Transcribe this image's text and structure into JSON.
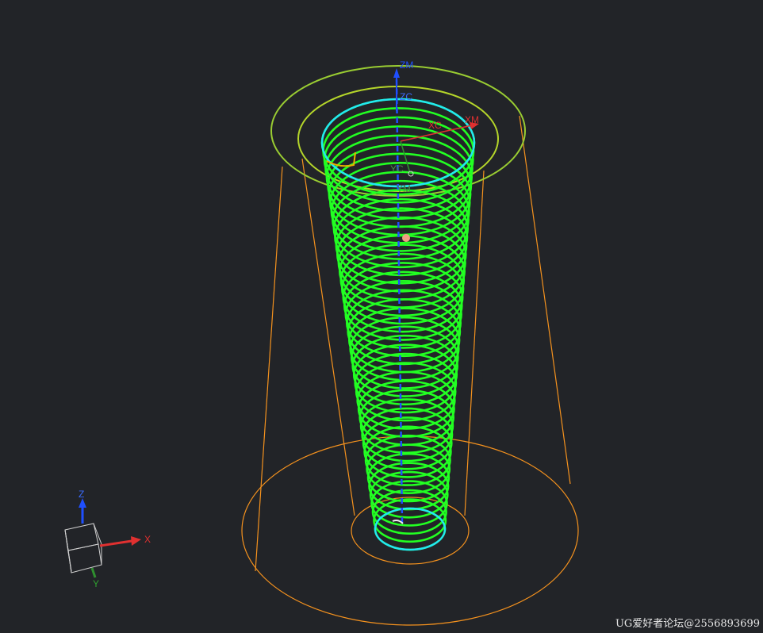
{
  "viewport": {
    "background": "#222428",
    "watermark": "UG爱好者论坛@2556893699"
  },
  "colors": {
    "helix": "#22ff22",
    "edge_cyan": "#22e8f0",
    "bounding": "#f5921e",
    "flange": "#9acd32",
    "axis_z": "#1f4fff",
    "axis_x": "#e03030",
    "axis_y": "#2f8f2f"
  },
  "model": {
    "helix_turns": 46,
    "axis_labels": {
      "zm": "ZM",
      "zc": "ZC",
      "xc": "XC",
      "xm": "XM",
      "yc": "YC",
      "ym": "YM"
    }
  },
  "triad": {
    "z_label": "Z",
    "x_label": "X",
    "y_label": "Y"
  }
}
